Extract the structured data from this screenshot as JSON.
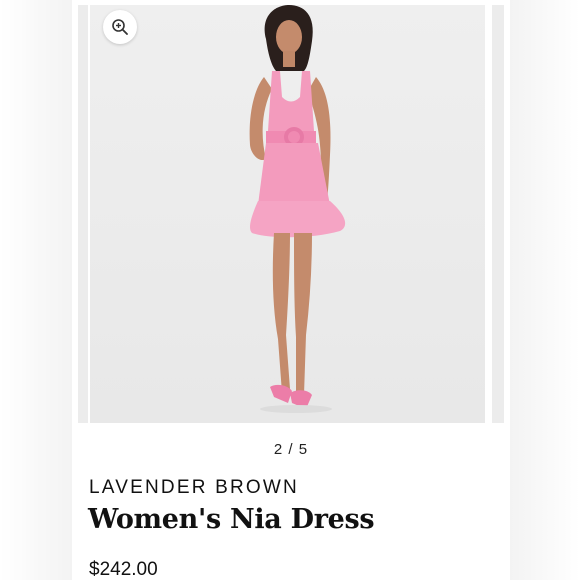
{
  "gallery": {
    "current_slide": 2,
    "counter_text": "2 / 5",
    "zoom_icon": "zoom-in-icon",
    "image_alt": "model-wearing-pink-mini-dress"
  },
  "product": {
    "brand": "LAVENDER BROWN",
    "title": "Women's Nia Dress",
    "price": "$242.00"
  },
  "colors": {
    "dress_pink": "#f39bbd",
    "photo_background": "#efefef",
    "text": "#111111"
  }
}
